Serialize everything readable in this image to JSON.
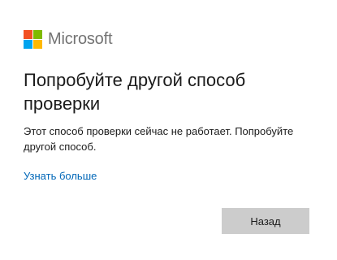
{
  "brand": {
    "name": "Microsoft",
    "logo_colors": [
      "#f25022",
      "#7fba00",
      "#00a4ef",
      "#ffb900"
    ]
  },
  "dialog": {
    "title": "Попробуйте другой способ проверки",
    "message": "Этот способ проверки сейчас не работает. Попробуйте другой способ.",
    "learn_more_link": "Узнать больше",
    "back_button": "Назад"
  },
  "colors": {
    "link": "#0067b8",
    "button_bg": "#cccccc",
    "text": "#1b1b1b"
  }
}
